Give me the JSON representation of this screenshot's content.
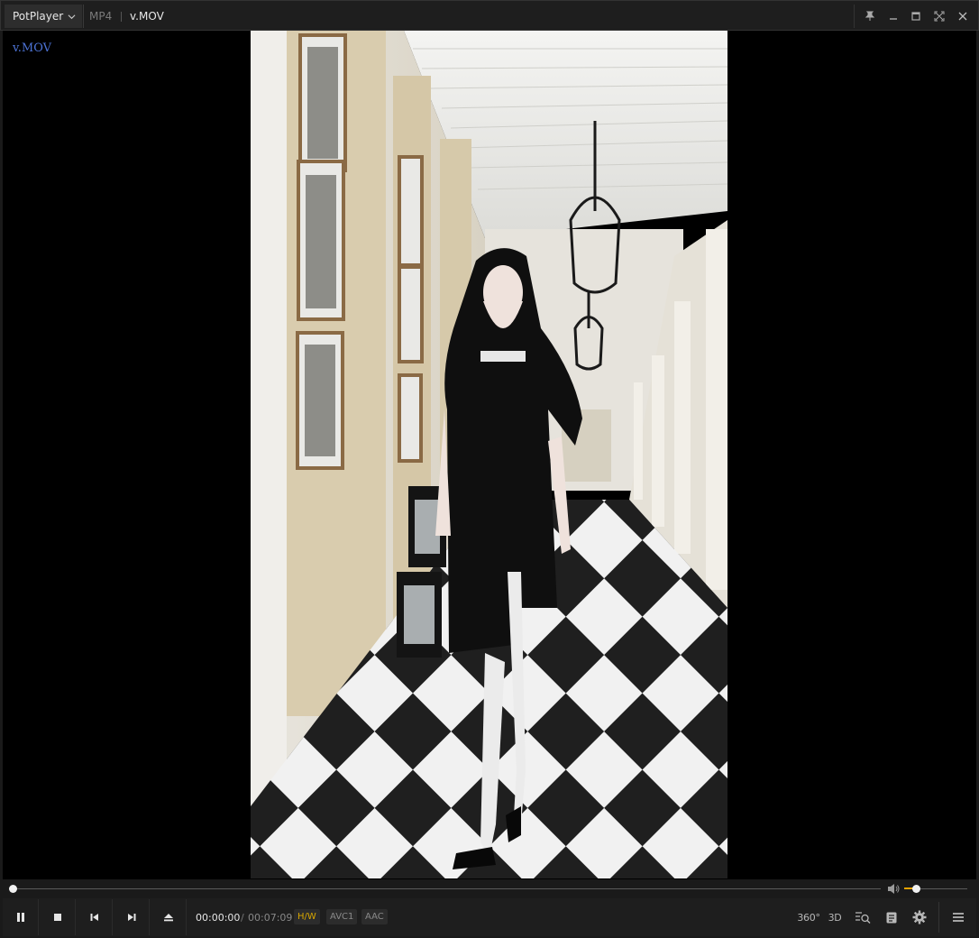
{
  "titlebar": {
    "app_name": "PotPlayer",
    "format": "MP4",
    "file_title": "v.MOV"
  },
  "overlay": {
    "filename": "v.MOV"
  },
  "playback": {
    "position_fraction": 0.0,
    "volume_fraction": 0.18
  },
  "controls": {
    "current_time": "00:00:00",
    "time_separator": "/",
    "total_time": "00:07:09",
    "badges": {
      "hw": "H/W",
      "video_codec": "AVC1",
      "audio_codec": "AAC"
    },
    "right_icons": {
      "vr": "360°",
      "three_d": "3D"
    }
  },
  "icons": [
    "chevron-down-icon",
    "pin-icon",
    "minimize-icon",
    "maximize-icon",
    "fullscreen-icon",
    "close-icon",
    "pause-icon",
    "stop-icon",
    "previous-icon",
    "next-icon",
    "eject-icon",
    "volume-icon",
    "playlist-search-icon",
    "chapter-icon",
    "gear-icon",
    "menu-icon"
  ],
  "colors": {
    "accent": "#e6a300",
    "overlay_text": "#4d73d6",
    "background": "#1a1a1a"
  }
}
